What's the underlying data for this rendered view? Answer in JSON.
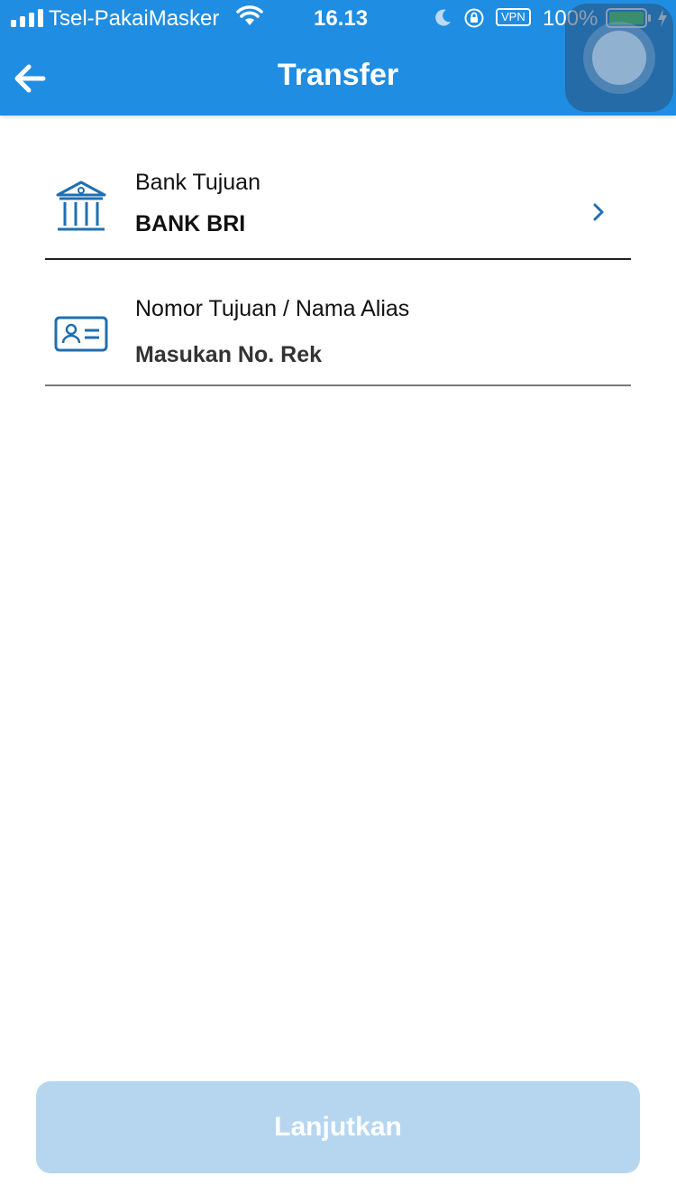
{
  "status_bar": {
    "carrier": "Tsel-PakaiMasker",
    "time": "16.13",
    "vpn_label": "VPN",
    "battery_percent": "100%",
    "battery_level": 1.0,
    "icons": [
      "signal-icon",
      "wifi-icon",
      "moon-icon",
      "rotation-lock-icon",
      "battery-icon",
      "charging-bolt-icon"
    ]
  },
  "header": {
    "title": "Transfer",
    "back_icon": "arrow-left-icon",
    "background_color": "#1f8de2"
  },
  "form": {
    "bank_field": {
      "label": "Bank Tujuan",
      "value": "BANK BRI",
      "icon": "bank-icon",
      "trailing_icon": "chevron-right-icon"
    },
    "account_field": {
      "label": "Nomor Tujuan / Nama Alias",
      "placeholder": "Masukan No. Rek",
      "icon": "id-card-icon"
    }
  },
  "footer": {
    "submit_label": "Lanjutkan",
    "submit_color": "#b6d6f0"
  },
  "accent_color": "#1f6fb0"
}
